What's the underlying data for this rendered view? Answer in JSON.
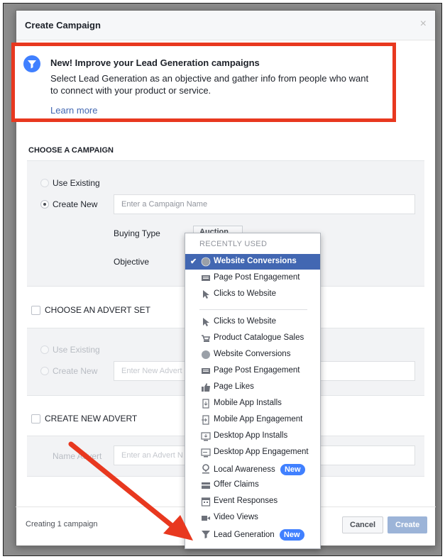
{
  "modal": {
    "title": "Create Campaign",
    "close": "×"
  },
  "banner": {
    "title": "New! Improve your Lead Generation campaigns",
    "description": "Select Lead Generation as an objective and gather info from people who want to connect with your product or service.",
    "link": "Learn more"
  },
  "campaign": {
    "section_title": "CHOOSE A CAMPAIGN",
    "use_existing": "Use Existing",
    "create_new": "Create New",
    "name_placeholder": "Enter a Campaign Name",
    "buying_type_label": "Buying Type",
    "buying_type_value": "Auction",
    "objective_label": "Objective"
  },
  "advert_set": {
    "section_title": "CHOOSE AN ADVERT SET",
    "use_existing": "Use Existing",
    "create_new": "Create New",
    "name_placeholder": "Enter New Advert"
  },
  "advert": {
    "section_title": "CREATE NEW ADVERT",
    "name_label": "Name Advert",
    "name_placeholder": "Enter an Advert N"
  },
  "footer": {
    "status": "Creating 1 campaign",
    "cancel": "Cancel",
    "create": "Create"
  },
  "dropdown": {
    "header": "RECENTLY USED",
    "recent": [
      {
        "label": "Website Conversions",
        "icon": "globe-icon",
        "selected": true
      },
      {
        "label": "Page Post Engagement",
        "icon": "post-icon"
      },
      {
        "label": "Clicks to Website",
        "icon": "cursor-icon"
      }
    ],
    "all": [
      {
        "label": "Clicks to Website",
        "icon": "cursor-icon"
      },
      {
        "label": "Product Catalogue Sales",
        "icon": "cart-icon"
      },
      {
        "label": "Website Conversions",
        "icon": "globe-icon"
      },
      {
        "label": "Page Post Engagement",
        "icon": "post-icon"
      },
      {
        "label": "Page Likes",
        "icon": "thumbs-up-icon"
      },
      {
        "label": "Mobile App Installs",
        "icon": "mobile-install-icon"
      },
      {
        "label": "Mobile App Engagement",
        "icon": "mobile-engage-icon"
      },
      {
        "label": "Desktop App Installs",
        "icon": "desktop-install-icon"
      },
      {
        "label": "Desktop App Engagement",
        "icon": "desktop-engage-icon"
      },
      {
        "label": "Local Awareness",
        "icon": "map-pin-icon",
        "badge": "New"
      },
      {
        "label": "Offer Claims",
        "icon": "offer-icon"
      },
      {
        "label": "Event Responses",
        "icon": "calendar-icon"
      },
      {
        "label": "Video Views",
        "icon": "video-icon"
      },
      {
        "label": "Lead Generation",
        "icon": "funnel-icon",
        "badge": "New"
      }
    ]
  },
  "colors": {
    "accent": "#4267b2",
    "highlight_red": "#e8381f",
    "badge_blue": "#4080ff"
  }
}
